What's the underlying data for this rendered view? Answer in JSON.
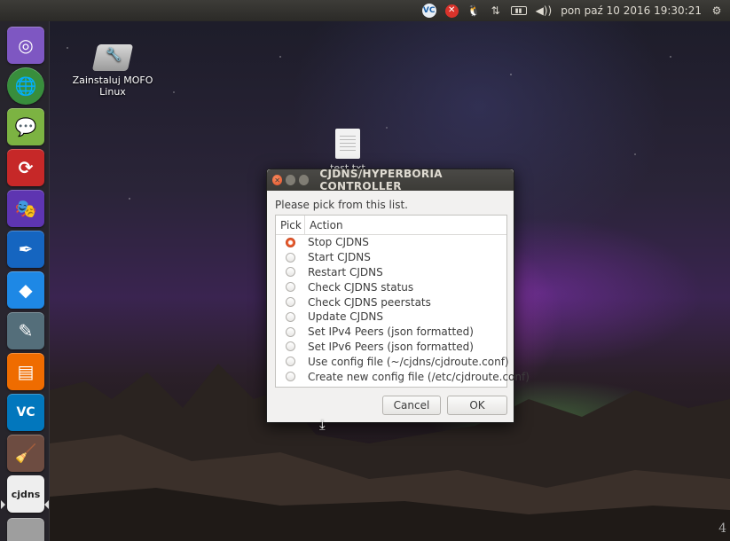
{
  "top_panel": {
    "network_icon": "updown-arrows-icon",
    "volume_icon": "speaker-icon",
    "datetime": "pon paź 10 2016 19:30:21",
    "settings_icon": "gear-icon"
  },
  "launcher": {
    "items": [
      {
        "name": "ubuntu-dash",
        "color": "#7e57c2"
      },
      {
        "name": "globe-browser",
        "color": "#2e7d32"
      },
      {
        "name": "chat",
        "color": "#7cb342"
      },
      {
        "name": "sync",
        "color": "#c62828"
      },
      {
        "name": "mask-app",
        "color": "#5e35b1"
      },
      {
        "name": "pen-app",
        "color": "#1565c0"
      },
      {
        "name": "kodi",
        "color": "#1e88e5"
      },
      {
        "name": "text-editor",
        "color": "#546e7a"
      },
      {
        "name": "archive",
        "color": "#ef6c00"
      },
      {
        "name": "veracrypt",
        "color": "#0277bd"
      },
      {
        "name": "bleachbit",
        "color": "#6d4c41"
      },
      {
        "name": "cjdns",
        "color": "#eeeeee"
      }
    ]
  },
  "desktop": {
    "install_icon_label_line1": "Zainstaluj MOFO",
    "install_icon_label_line2": "Linux",
    "file_label": "test.txt"
  },
  "dialog": {
    "title": "CJDNS/HYPERBORIA CONTROLLER",
    "prompt": "Please pick from this list.",
    "columns": {
      "pick": "Pick",
      "action": "Action"
    },
    "rows": [
      {
        "label": "Stop CJDNS",
        "selected": true
      },
      {
        "label": "Start CJDNS",
        "selected": false
      },
      {
        "label": "Restart CJDNS",
        "selected": false
      },
      {
        "label": "Check CJDNS status",
        "selected": false
      },
      {
        "label": "Check CJDNS peerstats",
        "selected": false
      },
      {
        "label": "Update CJDNS",
        "selected": false
      },
      {
        "label": "Set IPv4 Peers (json formatted)",
        "selected": false
      },
      {
        "label": "Set IPv6 Peers  (json formatted)",
        "selected": false
      },
      {
        "label": "Use config file (~/cjdns/cjdroute.conf)",
        "selected": false
      },
      {
        "label": "Create new config file (/etc/cjdroute.conf)",
        "selected": false
      }
    ],
    "cancel_label": "Cancel",
    "ok_label": "OK"
  },
  "corner_text": "4"
}
